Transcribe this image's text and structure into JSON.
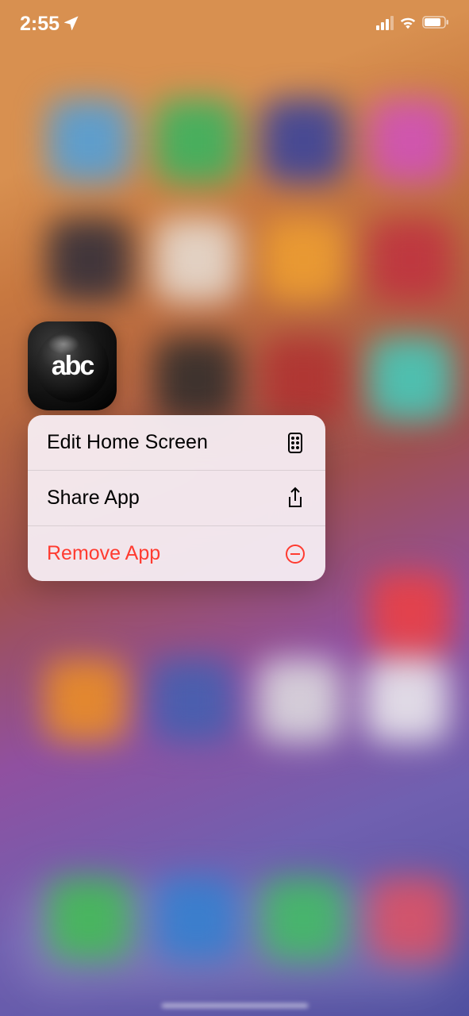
{
  "status_bar": {
    "time": "2:55",
    "location_active": true,
    "signal_strength": 3,
    "wifi_active": true,
    "battery_level": 75
  },
  "app": {
    "name": "abc",
    "icon_label": "abc"
  },
  "context_menu": {
    "items": [
      {
        "label": "Edit Home Screen",
        "icon": "phone-grid",
        "destructive": false
      },
      {
        "label": "Share App",
        "icon": "share",
        "destructive": false
      },
      {
        "label": "Remove App",
        "icon": "minus-circle",
        "destructive": true
      }
    ]
  }
}
